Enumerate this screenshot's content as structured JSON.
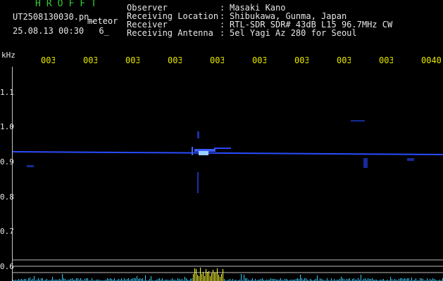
{
  "header": {
    "logo": "HROFFT",
    "filename": "UT2508130030.pn_",
    "meteor_label": "meteor",
    "datetime": "25.08.13 00:30",
    "counter": "6_"
  },
  "info": [
    {
      "key": "Observer",
      "value": "Masaki Kano"
    },
    {
      "key": "Receiving Location",
      "value": "Shibukawa, Gunma, Japan"
    },
    {
      "key": "Receiver",
      "value": "RTL-SDR SDR# 43dB L15 96.7MHz CW"
    },
    {
      "key": "Receiving Antenna",
      "value": "5el Yagi Az 280 for Seoul"
    }
  ],
  "separator": ":",
  "axis": {
    "unit": "kHz",
    "y_labels": [
      "1.1",
      "1.0",
      "0.9",
      "0.8",
      "0.7",
      "0.6"
    ],
    "time_labels": [
      "003",
      "003",
      "003",
      "003",
      "003",
      "003",
      "003",
      "003",
      "003",
      "0040"
    ]
  },
  "colors": {
    "header_green": "#33cc33",
    "text_white": "#e8e8e8",
    "time_yellow": "#e6e600",
    "signal_blue": "#2a4cff",
    "meter_cyan": "#33ccff",
    "meter_yellow": "#ffff33"
  }
}
